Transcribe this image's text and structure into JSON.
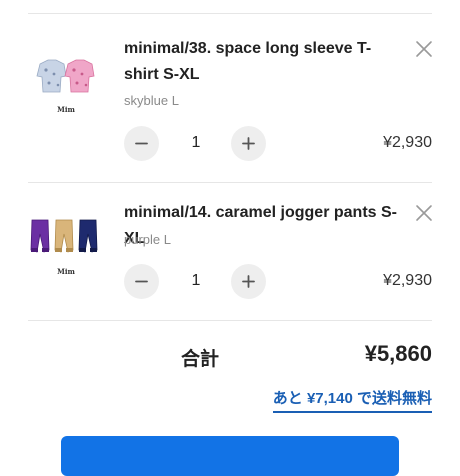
{
  "cart": {
    "items": [
      {
        "name": "minimal/38. space long sleeve T-shirt S-XL",
        "variant": "skyblue L",
        "quantity": "1",
        "price": "¥2,930",
        "brand_mark": "Mim"
      },
      {
        "name": "minimal/14. caramel jogger pants S-XL",
        "variant": "purple L",
        "quantity": "1",
        "price": "¥2,930",
        "brand_mark": "Mim"
      }
    ],
    "icons": {
      "decrease": "minus-icon",
      "increase": "plus-icon",
      "remove": "close-icon"
    }
  },
  "summary": {
    "total_label": "合計",
    "total_value": "¥5,860",
    "free_shipping_text": "あと ¥7,140 で送料無料"
  },
  "colors": {
    "accent": "#1273e6",
    "link": "#1a5fb4",
    "button_bg": "#eeeeee",
    "muted_text": "#8a8a8a"
  }
}
